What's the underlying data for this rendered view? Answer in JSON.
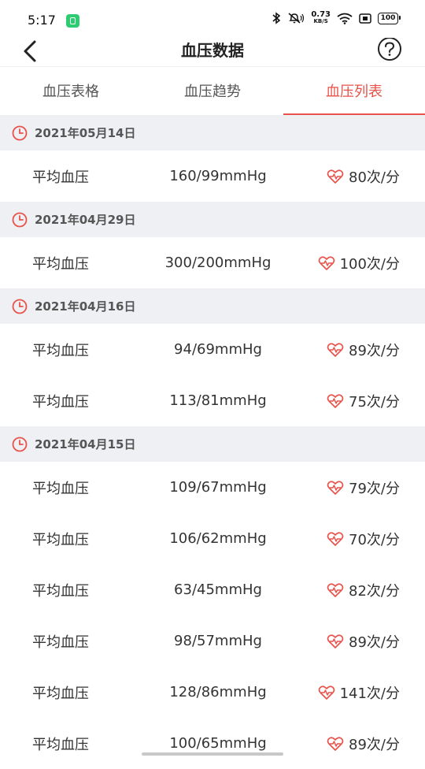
{
  "status_bar": {
    "time": "5:17",
    "net_speed": "0.73",
    "net_unit": "KB/S",
    "battery": "100"
  },
  "header": {
    "title": "血压数据",
    "back_icon": "chevron-left-icon",
    "help_icon": "question-circle-icon"
  },
  "tabs": [
    {
      "label": "血压表格",
      "active": false
    },
    {
      "label": "血压趋势",
      "active": false
    },
    {
      "label": "血压列表",
      "active": true
    }
  ],
  "colors": {
    "accent": "#e8524a",
    "section_bg": "#eef0f3"
  },
  "groups": [
    {
      "date": "2021年05月14日",
      "records": [
        {
          "label": "平均血压",
          "bp": "160/99mmHg",
          "hr": "80次/分"
        }
      ]
    },
    {
      "date": "2021年04月29日",
      "records": [
        {
          "label": "平均血压",
          "bp": "300/200mmHg",
          "hr": "100次/分"
        }
      ]
    },
    {
      "date": "2021年04月16日",
      "records": [
        {
          "label": "平均血压",
          "bp": "94/69mmHg",
          "hr": "89次/分"
        },
        {
          "label": "平均血压",
          "bp": "113/81mmHg",
          "hr": "75次/分"
        }
      ]
    },
    {
      "date": "2021年04月15日",
      "records": [
        {
          "label": "平均血压",
          "bp": "109/67mmHg",
          "hr": "79次/分"
        },
        {
          "label": "平均血压",
          "bp": "106/62mmHg",
          "hr": "70次/分"
        },
        {
          "label": "平均血压",
          "bp": "63/45mmHg",
          "hr": "82次/分"
        },
        {
          "label": "平均血压",
          "bp": "98/57mmHg",
          "hr": "89次/分"
        },
        {
          "label": "平均血压",
          "bp": "128/86mmHg",
          "hr": "141次/分"
        },
        {
          "label": "平均血压",
          "bp": "100/65mmHg",
          "hr": "89次/分"
        }
      ]
    }
  ]
}
